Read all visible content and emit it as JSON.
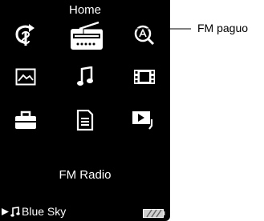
{
  "screen": {
    "title": "Home",
    "selected_label": "FM Radio",
    "grid": [
      {
        "icon": "shuffle-icon"
      },
      {
        "icon": "radio-icon"
      },
      {
        "icon": "search-icon"
      },
      {
        "icon": "photo-icon"
      },
      {
        "icon": "music-note-icon"
      },
      {
        "icon": "video-icon"
      },
      {
        "icon": "settings-toolbox-icon"
      },
      {
        "icon": "document-icon"
      },
      {
        "icon": "slideshow-icon"
      }
    ],
    "status_bar": {
      "song": "♫ Blue Sky",
      "song_title": "Blue Sky"
    }
  },
  "callout": {
    "label": "FM paguo"
  }
}
